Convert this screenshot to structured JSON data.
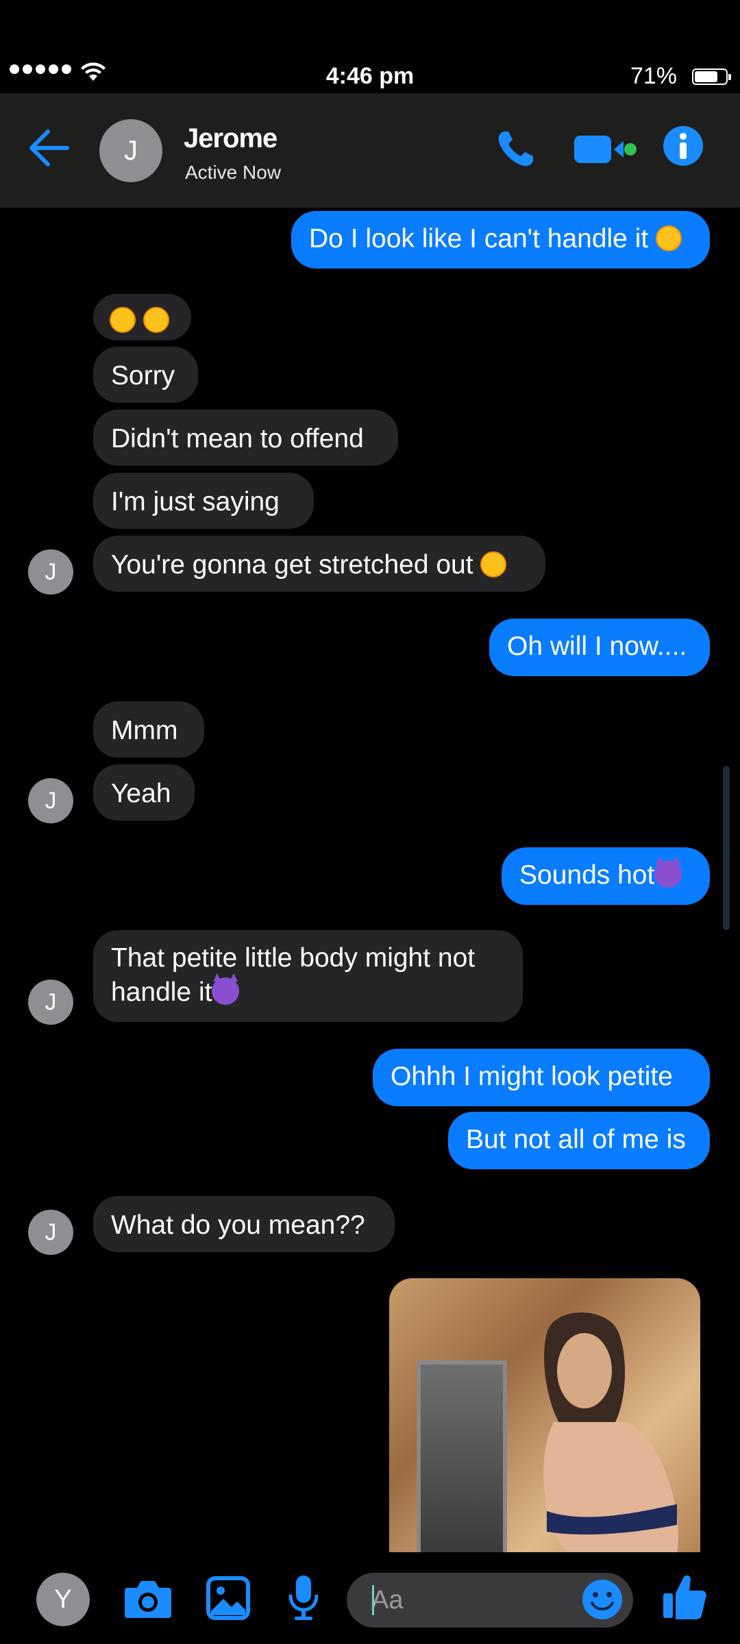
{
  "status": {
    "time": "4:46 pm",
    "battery": "71%"
  },
  "header": {
    "avatar_initial": "J",
    "name": "Jerome",
    "presence": "Active Now"
  },
  "messages": [
    {
      "dir": "out",
      "text": "Do I look like I can't handle it"
    },
    {
      "dir": "in",
      "text": ""
    },
    {
      "dir": "in",
      "text": "Sorry"
    },
    {
      "dir": "in",
      "text": "Didn't mean to offend"
    },
    {
      "dir": "in",
      "text": "I'm just saying"
    },
    {
      "dir": "in",
      "text": "You're gonna get stretched out"
    },
    {
      "dir": "out",
      "text": "Oh will I now...."
    },
    {
      "dir": "in",
      "text": "Mmm"
    },
    {
      "dir": "in",
      "text": "Yeah"
    },
    {
      "dir": "out",
      "text": "Sounds hot"
    },
    {
      "dir": "in",
      "text_line1": "That petite little body might not",
      "text_line2": "handle it"
    },
    {
      "dir": "out",
      "text": "Ohhh I might look petite"
    },
    {
      "dir": "out",
      "text": "But not all of me is"
    },
    {
      "dir": "in",
      "text": "What do you mean??"
    }
  ],
  "avatar_initial_small": "J",
  "composer": {
    "me_initial": "Y",
    "placeholder": "Aa"
  },
  "colors": {
    "outgoing": "#0a7cff",
    "incoming": "#252527",
    "accent": "#0a7cff"
  }
}
